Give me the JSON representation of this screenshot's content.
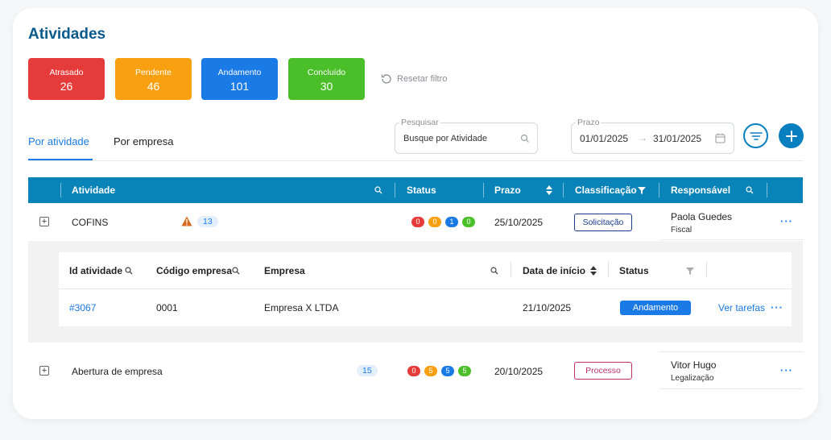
{
  "page": {
    "title": "Atividades"
  },
  "stats": [
    {
      "label": "Atrasado",
      "value": "26",
      "color": "#e63b3b"
    },
    {
      "label": "Pendente",
      "value": "46",
      "color": "#f9a011"
    },
    {
      "label": "Andamento",
      "value": "101",
      "color": "#1a7ae6"
    },
    {
      "label": "Concluído",
      "value": "30",
      "color": "#4bbf2a"
    }
  ],
  "reset_filter": {
    "label": "Resetar filtro",
    "icon": "refresh-icon"
  },
  "tabs": [
    {
      "label": "Por atividade",
      "active": true
    },
    {
      "label": "Por empresa",
      "active": false
    }
  ],
  "search": {
    "label": "Pesquisar",
    "value": "Busque por Atividade",
    "icon": "search-icon"
  },
  "date_range": {
    "label": "Prazo",
    "start": "01/01/2025",
    "separator": "→",
    "end": "31/01/2025",
    "icon": "calendar-icon"
  },
  "toolbar": {
    "filter_icon": "filter-lines-icon",
    "add_icon": "plus-icon"
  },
  "table": {
    "headers": {
      "atividade": "Atividade",
      "status": "Status",
      "prazo": "Prazo",
      "classificacao": "Classificação",
      "responsavel": "Responsável"
    },
    "rows": [
      {
        "expand": "+",
        "atividade": "COFINS",
        "warning_icon": "warning-icon",
        "count": "13",
        "status_counts": [
          "0",
          "0",
          "1",
          "0"
        ],
        "prazo": "25/10/2025",
        "classificacao": "Solicitação",
        "responsavel_nome": "Paola Guedes",
        "responsavel_dept": "Fiscal",
        "more": "···"
      },
      {
        "expand": "+",
        "atividade": "Abertura de empresa",
        "count": "15",
        "status_counts": [
          "0",
          "5",
          "5",
          "5"
        ],
        "prazo": "20/10/2025",
        "classificacao": "Processo",
        "responsavel_nome": "Vitor Hugo",
        "responsavel_dept": "Legalização",
        "more": "···"
      }
    ]
  },
  "subtable": {
    "headers": {
      "id": "Id atividade",
      "codigo": "Código empresa",
      "empresa": "Empresa",
      "data_inicio": "Data de início",
      "status": "Status"
    },
    "rows": [
      {
        "id": "#3067",
        "codigo": "0001",
        "empresa": "Empresa X LTDA",
        "data_inicio": "21/10/2025",
        "status": "Andamento",
        "action": "Ver tarefas",
        "more": "···"
      }
    ]
  }
}
